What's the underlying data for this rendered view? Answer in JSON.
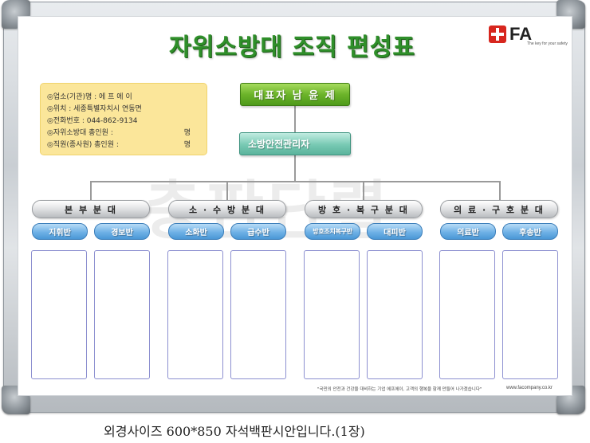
{
  "title": "자위소방대 조직 편성표",
  "logo": {
    "text": "FA",
    "tagline": "The key for your safety"
  },
  "info_box": {
    "rows": [
      {
        "label": "◎업소(기관)명 : 에 프 에 이",
        "unit": ""
      },
      {
        "label": "◎위치 : 세종특별자치시 연동면",
        "unit": ""
      },
      {
        "label": "◎전화번호 : 044-862-9134",
        "unit": ""
      },
      {
        "label": "◎자위소방대 총인원 :",
        "unit": "명"
      },
      {
        "label": "◎직원(종사원) 총인원 :",
        "unit": "명"
      }
    ]
  },
  "representative": "대표자 남 윤 제",
  "manager": "소방안전관리자",
  "divisions": [
    {
      "name": "본 부 분 대",
      "teams": [
        "지휘반",
        "경보반"
      ]
    },
    {
      "name": "소 · 수 방 분 대",
      "teams": [
        "소화반",
        "급수반"
      ]
    },
    {
      "name": "방 호 · 복 구 분 대",
      "teams": [
        "방호조치복구반",
        "대피반"
      ]
    },
    {
      "name": "의 료 · 구 호 분 대",
      "teams": [
        "의료반",
        "후송반"
      ]
    }
  ],
  "watermark": "충판단렬",
  "footer": {
    "slogan": "\"국민의 안전과 건강을 대비하는 기업 에프에이, 고객의 행복을 함께 만들어 나가겠습니다\"",
    "website": "www.facompany.co.kr"
  },
  "caption": "외경사이즈 600*850 자석백판시안입니다.(1장)",
  "colors": {
    "title": "#2f8f2a",
    "info_box": "#fbe69a",
    "representative": "#6cb42a",
    "manager": "#77c9b3",
    "team": "#6fb1e6",
    "panel_border": "#8c8fd0",
    "logo_red": "#d7261e"
  }
}
